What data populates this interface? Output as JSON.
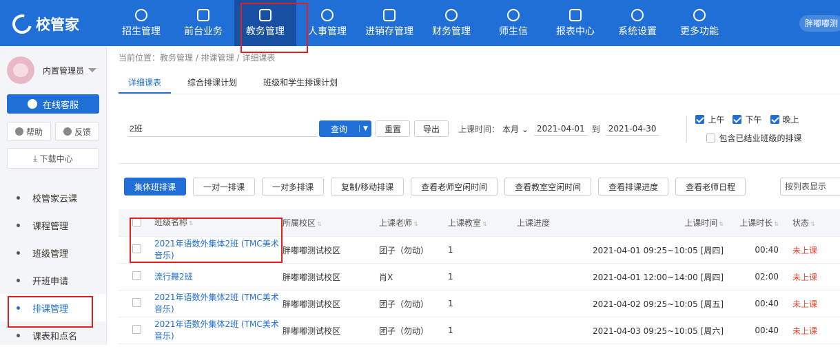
{
  "app": {
    "logo_text": "校管家",
    "user_name": "胖嘟嘟测"
  },
  "nav": [
    {
      "label": "招生管理",
      "icon": "person-add-icon"
    },
    {
      "label": "前台业务",
      "icon": "monitor-icon"
    },
    {
      "label": "教务管理",
      "icon": "book-icon",
      "active": true
    },
    {
      "label": "人事管理",
      "icon": "person-icon"
    },
    {
      "label": "进销存管理",
      "icon": "inbox-icon"
    },
    {
      "label": "财务管理",
      "icon": "money-icon"
    },
    {
      "label": "师生信",
      "icon": "chat-icon"
    },
    {
      "label": "报表中心",
      "icon": "report-icon"
    },
    {
      "label": "系统设置",
      "icon": "settings-icon"
    },
    {
      "label": "更多功能",
      "icon": "more-icon"
    }
  ],
  "sidebar": {
    "profile_name": "内置管理员",
    "cs_label": "在线客服",
    "help_label": "帮助",
    "feedback_label": "反馈",
    "download_label": "下载中心",
    "menu": [
      {
        "label": "校管家云课"
      },
      {
        "label": "课程管理"
      },
      {
        "label": "班级管理"
      },
      {
        "label": "开班申请"
      },
      {
        "label": "排课管理",
        "active": true
      },
      {
        "label": "课表和点名"
      }
    ]
  },
  "breadcrumb": "当前位置：教务管理 / 排课管理 / 详细课表",
  "tabs": [
    "详细课表",
    "综合排课计划",
    "班级和学生排课计划"
  ],
  "filter": {
    "search_value": "2班",
    "query_label": "查询",
    "reset_label": "重置",
    "export_label": "导出",
    "date_label": "上课时间：",
    "month_option": "本月",
    "date_from": "2021-04-01",
    "to_label": "到",
    "date_to": "2021-04-30",
    "morning": "上午",
    "afternoon": "下午",
    "evening": "晚上",
    "include_closed": "包含已结业班级的排课"
  },
  "actions": [
    "集体班排课",
    "一对一排课",
    "一对多排课",
    "复制/移动排课",
    "查看老师空闲时间",
    "查看教室空闲时间",
    "查看排课进度",
    "查看老师日程"
  ],
  "view_select": "按列表显示",
  "table": {
    "headers": {
      "name": "班级名称",
      "campus": "所属校区",
      "teacher": "上课老师",
      "room": "上课教室",
      "progress": "上课进度",
      "time": "上课时间",
      "duration": "上课时长",
      "status": "状态"
    },
    "rows": [
      {
        "name": "2021年语数外集体2班 (TMC美术音乐)",
        "campus": "胖嘟嘟测试校区",
        "teacher": "团子（勿动）",
        "room": "1",
        "time": "2021-04-01 09:25~10:05 [周四]",
        "duration": "00:40",
        "status": "未上课"
      },
      {
        "name": "流行舞2班",
        "campus": "胖嘟嘟测试校区",
        "teacher": "肖X",
        "room": "1",
        "time": "2021-04-01 12:00~14:00 [周四]",
        "duration": "02:00",
        "status": "未上课"
      },
      {
        "name": "2021年语数外集体2班 (TMC美术音乐)",
        "campus": "胖嘟嘟测试校区",
        "teacher": "团子（勿动）",
        "room": "1",
        "time": "2021-04-02 09:25~10:05 [周五]",
        "duration": "00:40",
        "status": "未上课"
      },
      {
        "name": "2021年语数外集体2班 (TMC美术音乐)",
        "campus": "胖嘟嘟测试校区",
        "teacher": "团子（勿动）",
        "room": "1",
        "time": "2021-04-03 09:25~10:05 [周六]",
        "duration": "00:40",
        "status": "未上课"
      }
    ]
  }
}
